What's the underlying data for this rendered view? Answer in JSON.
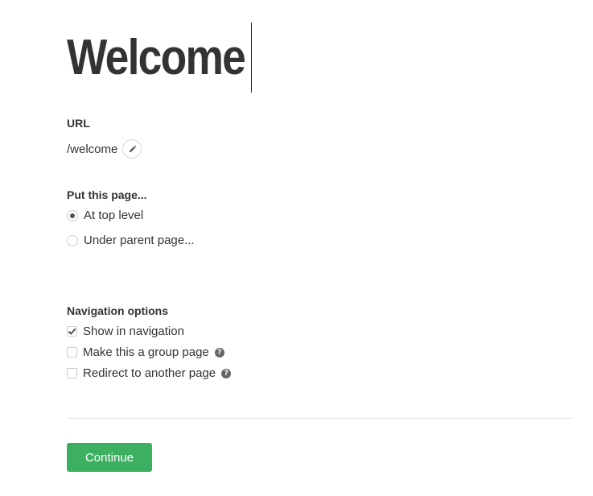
{
  "title": "Welcome",
  "url_section": {
    "label": "URL",
    "value": "/welcome",
    "edit_icon": "pencil-icon"
  },
  "placement": {
    "label": "Put this page...",
    "options": [
      {
        "label": "At top level",
        "selected": true
      },
      {
        "label": "Under parent page...",
        "selected": false
      }
    ]
  },
  "navigation": {
    "label": "Navigation options",
    "options": [
      {
        "label": "Show in navigation",
        "checked": true,
        "help": false
      },
      {
        "label": "Make this a group page",
        "checked": false,
        "help": true
      },
      {
        "label": "Redirect to another page",
        "checked": false,
        "help": true
      }
    ],
    "help_icon": "question-circle-icon",
    "help_glyph": "?"
  },
  "continue_button": {
    "label": "Continue",
    "color": "#3cb060"
  }
}
